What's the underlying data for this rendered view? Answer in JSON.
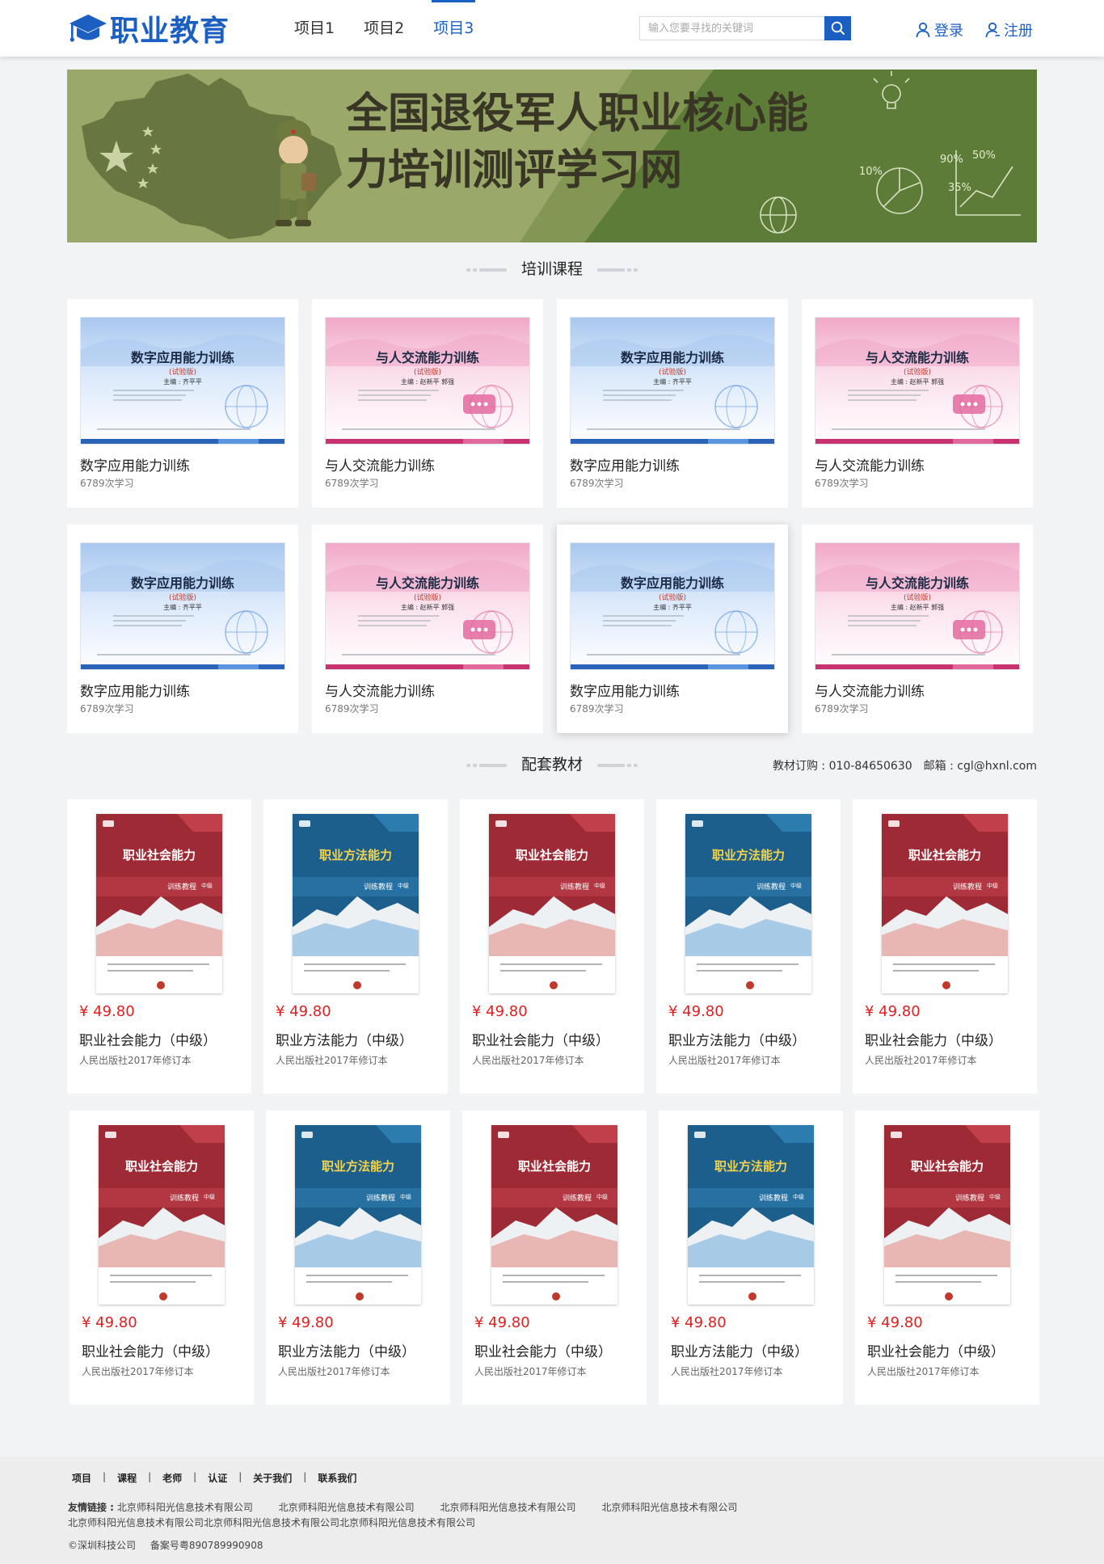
{
  "header": {
    "logo_text": "职业教育",
    "nav": [
      {
        "label": "项目1",
        "active": false
      },
      {
        "label": "项目2",
        "active": false
      },
      {
        "label": "项目3",
        "active": true
      }
    ],
    "search_placeholder": "输入您要寻找的关键词",
    "login_label": "登录",
    "register_label": "注册"
  },
  "banner": {
    "line1": "全国退役军人职业核心能",
    "line2": "力培训测评学习网",
    "chart_marks": [
      "10%",
      "50%",
      "90%",
      "35%"
    ]
  },
  "courses_section": {
    "title": "培训课程",
    "courses": [
      {
        "title": "数字应用能力训练",
        "count": "6789次学习",
        "theme": "blue",
        "cover_title": "数字应用能力训练",
        "cover_badge": "(试验版)",
        "cover_author": "主编 : 齐平平"
      },
      {
        "title": "与人交流能力训练",
        "count": "6789次学习",
        "theme": "pink",
        "cover_title": "与人交流能力训练",
        "cover_badge": "(试验版)",
        "cover_author": "主编 : 赵新平 郭强"
      },
      {
        "title": "数字应用能力训练",
        "count": "6789次学习",
        "theme": "blue",
        "cover_title": "数字应用能力训练",
        "cover_badge": "(试验版)",
        "cover_author": "主编 : 齐平平"
      },
      {
        "title": "与人交流能力训练",
        "count": "6789次学习",
        "theme": "pink",
        "cover_title": "与人交流能力训练",
        "cover_badge": "(试验版)",
        "cover_author": "主编 : 赵新平 郭强"
      },
      {
        "title": "数字应用能力训练",
        "count": "6789次学习",
        "theme": "blue",
        "cover_title": "数字应用能力训练",
        "cover_badge": "(试验版)",
        "cover_author": "主编 : 齐平平"
      },
      {
        "title": "与人交流能力训练",
        "count": "6789次学习",
        "theme": "pink",
        "cover_title": "与人交流能力训练",
        "cover_badge": "(试验版)",
        "cover_author": "主编 : 赵新平 郭强"
      },
      {
        "title": "数字应用能力训练",
        "count": "6789次学习",
        "theme": "blue",
        "cover_title": "数字应用能力训练",
        "cover_badge": "(试验版)",
        "cover_author": "主编 : 齐平平"
      },
      {
        "title": "与人交流能力训练",
        "count": "6789次学习",
        "theme": "pink",
        "cover_title": "与人交流能力训练",
        "cover_badge": "(试验版)",
        "cover_author": "主编 : 赵新平 郭强"
      }
    ]
  },
  "books_section": {
    "title": "配套教材",
    "contact": "教材订购 : 010-84650630　邮箱 : cgl@hxnl.com",
    "books": [
      {
        "price": "¥ 49.80",
        "title": "职业社会能力（中级）",
        "publisher": "人民出版社2017年修订本",
        "theme": "red",
        "cover_title": "职业社会能力",
        "cover_sub": "训练教程",
        "cover_level": "中级"
      },
      {
        "price": "¥ 49.80",
        "title": "职业方法能力（中级）",
        "publisher": "人民出版社2017年修订本",
        "theme": "blue",
        "cover_title": "职业方法能力",
        "cover_sub": "训练教程",
        "cover_level": "中级"
      },
      {
        "price": "¥ 49.80",
        "title": "职业社会能力（中级）",
        "publisher": "人民出版社2017年修订本",
        "theme": "red",
        "cover_title": "职业社会能力",
        "cover_sub": "训练教程",
        "cover_level": "中级"
      },
      {
        "price": "¥ 49.80",
        "title": "职业方法能力（中级）",
        "publisher": "人民出版社2017年修订本",
        "theme": "blue",
        "cover_title": "职业方法能力",
        "cover_sub": "训练教程",
        "cover_level": "中级"
      },
      {
        "price": "¥ 49.80",
        "title": "职业社会能力（中级）",
        "publisher": "人民出版社2017年修订本",
        "theme": "red",
        "cover_title": "职业社会能力",
        "cover_sub": "训练教程",
        "cover_level": "中级"
      },
      {
        "price": "¥ 49.80",
        "title": "职业社会能力（中级）",
        "publisher": "人民出版社2017年修订本",
        "theme": "red",
        "cover_title": "职业社会能力",
        "cover_sub": "训练教程",
        "cover_level": "中级"
      },
      {
        "price": "¥ 49.80",
        "title": "职业方法能力（中级）",
        "publisher": "人民出版社2017年修订本",
        "theme": "blue",
        "cover_title": "职业方法能力",
        "cover_sub": "训练教程",
        "cover_level": "中级"
      },
      {
        "price": "¥ 49.80",
        "title": "职业社会能力（中级）",
        "publisher": "人民出版社2017年修订本",
        "theme": "red",
        "cover_title": "职业社会能力",
        "cover_sub": "训练教程",
        "cover_level": "中级"
      },
      {
        "price": "¥ 49.80",
        "title": "职业方法能力（中级）",
        "publisher": "人民出版社2017年修订本",
        "theme": "blue",
        "cover_title": "职业方法能力",
        "cover_sub": "训练教程",
        "cover_level": "中级"
      },
      {
        "price": "¥ 49.80",
        "title": "职业社会能力（中级）",
        "publisher": "人民出版社2017年修订本",
        "theme": "red",
        "cover_title": "职业社会能力",
        "cover_sub": "训练教程",
        "cover_level": "中级"
      }
    ]
  },
  "footer": {
    "nav": [
      "项目",
      "课程",
      "老师",
      "认证",
      "关于我们",
      "联系我们"
    ],
    "links_label": "友情链接 :",
    "links": [
      "北京师科阳光信息技术有限公司",
      "北京师科阳光信息技术有限公司",
      "北京师科阳光信息技术有限公司",
      "北京师科阳光信息技术有限公司",
      "北京师科阳光信息技术有限公司",
      "北京师科阳光信息技术有限公司",
      "北京师科阳光信息技术有限公司"
    ],
    "copyright": "©深圳科技公司",
    "icp": "备案号粤890789990908"
  },
  "colors": {
    "primary": "#1b5fc2",
    "price": "#e02020",
    "banner_green": "#5a7a35",
    "banner_olive": "#9aa86a"
  }
}
